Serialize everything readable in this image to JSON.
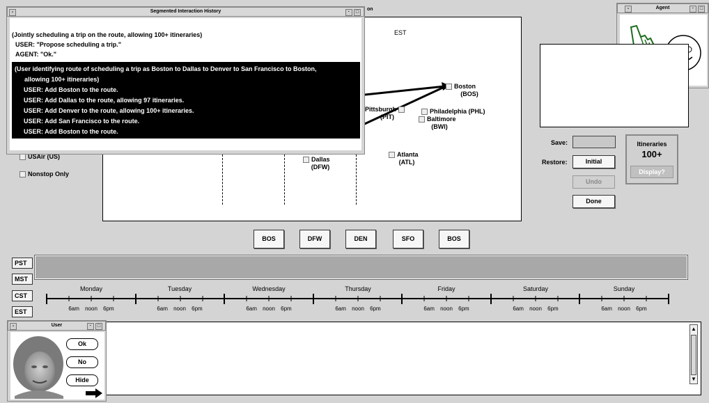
{
  "map": {
    "timezone": "EST",
    "title_fragment": "on",
    "checkboxes": [
      "USAir (US)",
      "Nonstop Only"
    ],
    "cities": {
      "boston": [
        "Boston",
        "(BOS)"
      ],
      "pittsburgh": [
        "Pittsburgh",
        "(PIT)"
      ],
      "philadelphia": "Philadelphia (PHL)",
      "baltimore": [
        "Baltimore",
        "(BWI)"
      ],
      "atlanta": [
        "Atlanta",
        "(ATL)"
      ],
      "dallas": [
        "Dallas",
        "(DFW)"
      ]
    }
  },
  "history": {
    "title": "Segmented Interaction History",
    "lines": [
      "(Jointly scheduling a trip on the route, allowing 100+ itineraries)",
      "USER:   \"Propose scheduling a trip.\"",
      "AGENT: \"Ok.\"",
      "(User identifying route of scheduling a trip as Boston to Dallas to Denver to San Francisco to Boston,",
      "allowing 100+ itineraries)",
      "USER:   Add Boston to the route.",
      "USER:   Add Dallas to the route, allowing 97 itineraries.",
      "USER:   Add Denver to the route, allowing 100+ itineraries.",
      "USER:   Add San Francisco to the route.",
      "USER:   Add Boston to the route."
    ]
  },
  "agent": {
    "title": "Agent"
  },
  "controls": {
    "save_label": "Save:",
    "restore_label": "Restore:",
    "initial": "Initial",
    "undo": "Undo",
    "done": "Done",
    "itineraries_label": "Itineraries",
    "itineraries_count": "100+",
    "display": "Display?"
  },
  "route": [
    "BOS",
    "DFW",
    "DEN",
    "SFO",
    "BOS"
  ],
  "timezones": [
    "PST",
    "MST",
    "CST",
    "EST"
  ],
  "days": [
    "Monday",
    "Tuesday",
    "Wednesday",
    "Thursday",
    "Friday",
    "Saturday",
    "Sunday"
  ],
  "hours": "6am noon 6pm",
  "user": {
    "title": "User",
    "ok": "Ok",
    "no": "No",
    "hide": "Hide"
  }
}
